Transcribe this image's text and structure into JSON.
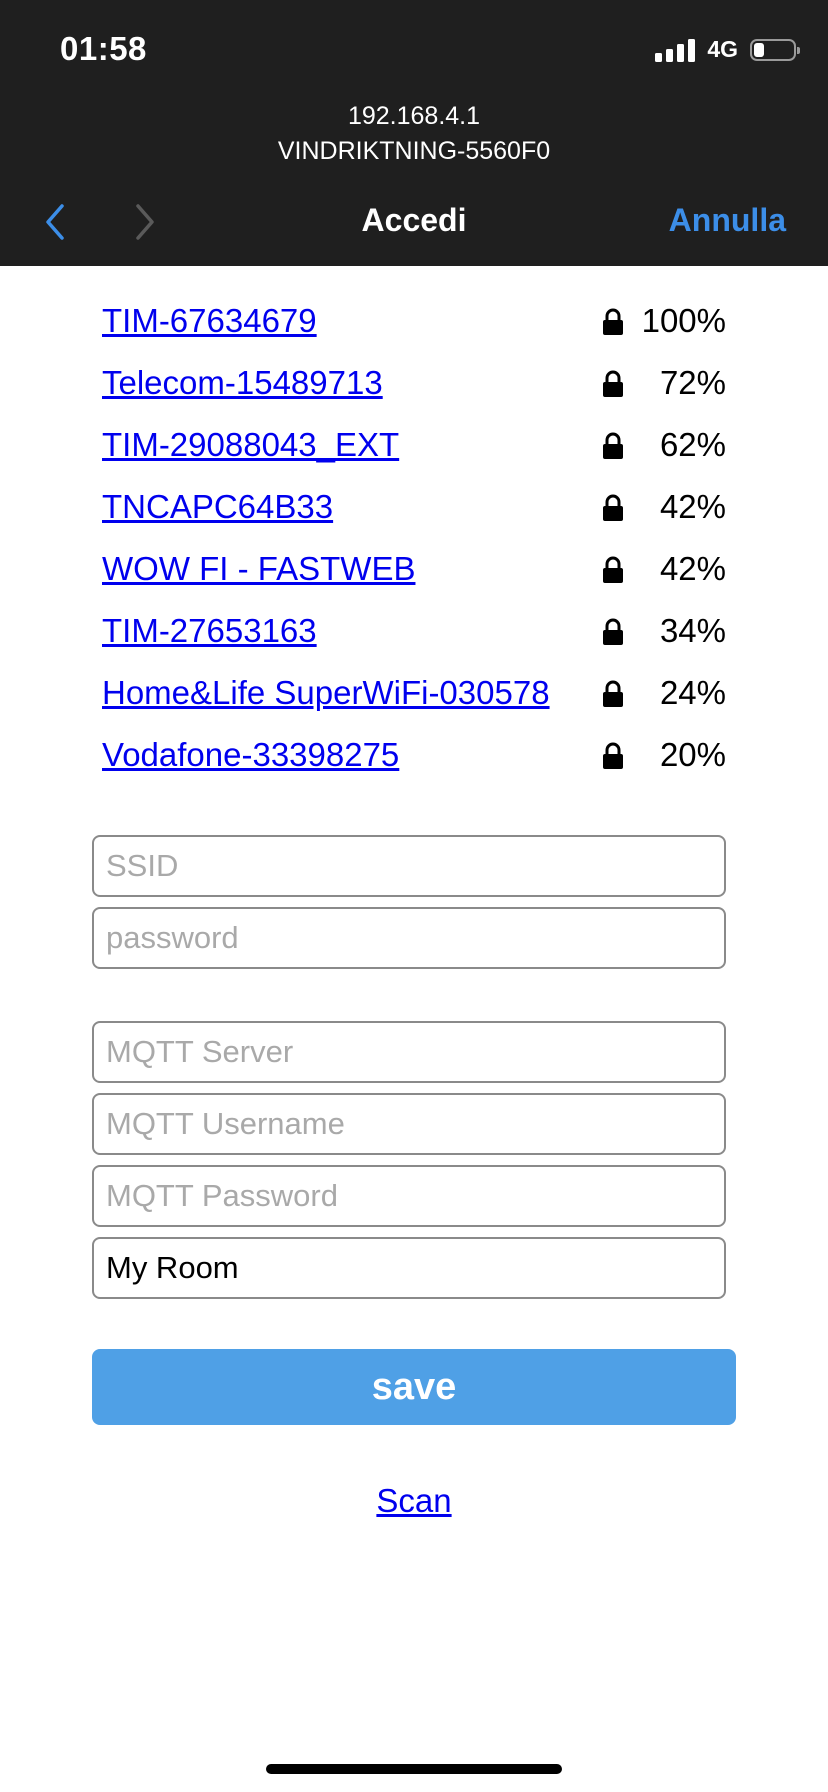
{
  "status_bar": {
    "time": "01:58",
    "network_type": "4G",
    "battery_level": 0.25,
    "signal_bars": 4
  },
  "browser": {
    "host": "192.168.4.1",
    "page_subtitle": "VINDRIKTNING-5560F0",
    "title": "Accedi",
    "cancel_label": "Annulla",
    "icons": {
      "back": "chevron-left-icon",
      "forward": "chevron-right-icon"
    },
    "accent_color": "#3c8ee8"
  },
  "networks": [
    {
      "ssid": "TIM-67634679",
      "secured": true,
      "quality": "100%"
    },
    {
      "ssid": "Telecom-15489713",
      "secured": true,
      "quality": "72%"
    },
    {
      "ssid": "TIM-29088043_EXT",
      "secured": true,
      "quality": "62%"
    },
    {
      "ssid": "TNCAPC64B33",
      "secured": true,
      "quality": "42%"
    },
    {
      "ssid": "WOW FI - FASTWEB",
      "secured": true,
      "quality": "42%"
    },
    {
      "ssid": "TIM-27653163",
      "secured": true,
      "quality": "34%"
    },
    {
      "ssid": "Home&Life SuperWiFi-030578",
      "secured": true,
      "quality": "24%"
    },
    {
      "ssid": "Vodafone-33398275",
      "secured": true,
      "quality": "20%"
    }
  ],
  "form": {
    "ssid": {
      "placeholder": "SSID",
      "value": ""
    },
    "password": {
      "placeholder": "password",
      "value": ""
    },
    "mqtt_server": {
      "placeholder": "MQTT Server",
      "value": ""
    },
    "mqtt_username": {
      "placeholder": "MQTT Username",
      "value": ""
    },
    "mqtt_password": {
      "placeholder": "MQTT Password",
      "value": ""
    },
    "room": {
      "placeholder": "",
      "value": "My Room"
    },
    "save_label": "save",
    "save_color": "#4fa0e6"
  },
  "scan_label": "Scan"
}
